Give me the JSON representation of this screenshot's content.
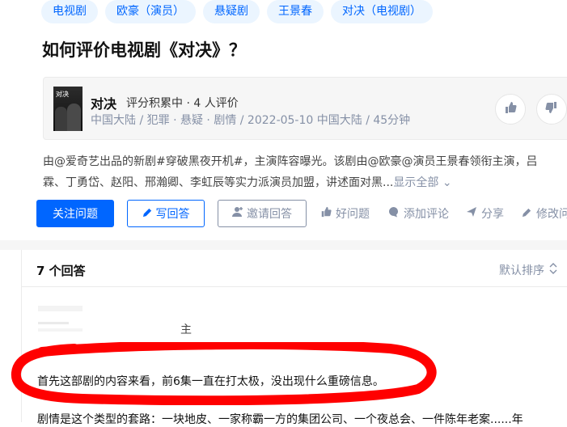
{
  "topics": [
    "电视剧",
    "欧豪（演员）",
    "悬疑剧",
    "王景春",
    "对决（电视剧）"
  ],
  "question_title": "如何评价电视剧《对决》？",
  "card": {
    "poster_text": "对决",
    "title": "对决",
    "score": "评分积累中 · 4 人评价",
    "meta": "中国大陆 / 犯罪 · 悬疑 · 剧情 / 2022-05-10 中国大陆 / 45分钟",
    "upvote_icon": "thumbs-up-icon",
    "downvote_icon": "thumbs-down-icon"
  },
  "description": {
    "line1": "由@爱奇艺出品的新剧#穿破黑夜开机#，主演阵容曝光。该剧由@欧豪@演员王景春领衔主演，吕",
    "line2": "霖、丁勇岱、赵阳、邢瀚卿、李虹辰等实力派演员加盟，讲述面对黑...",
    "show_all": "显示全部"
  },
  "actions": {
    "follow": "关注问题",
    "write": "写回答",
    "invite": "邀请回答",
    "good": "好问题",
    "comment": "添加评论",
    "share": "分享",
    "edit": "修改问"
  },
  "answers": {
    "count": "7 个回答",
    "sort": "默认排序",
    "author_fragment": "主",
    "line1": "首先这部剧的内容来看，前6集一直在打太极，没出现什么重磅信息。",
    "line2": "剧情是这个类型的套路：一块地皮、一家称霸一方的集团公司、一个夜总会、一件陈年老案......年"
  },
  "colors": {
    "brand_blue": "#0066ff",
    "tag_bg": "#ebf5ff",
    "meta_gray": "#8590a6",
    "annotation_red": "#ff0000"
  }
}
